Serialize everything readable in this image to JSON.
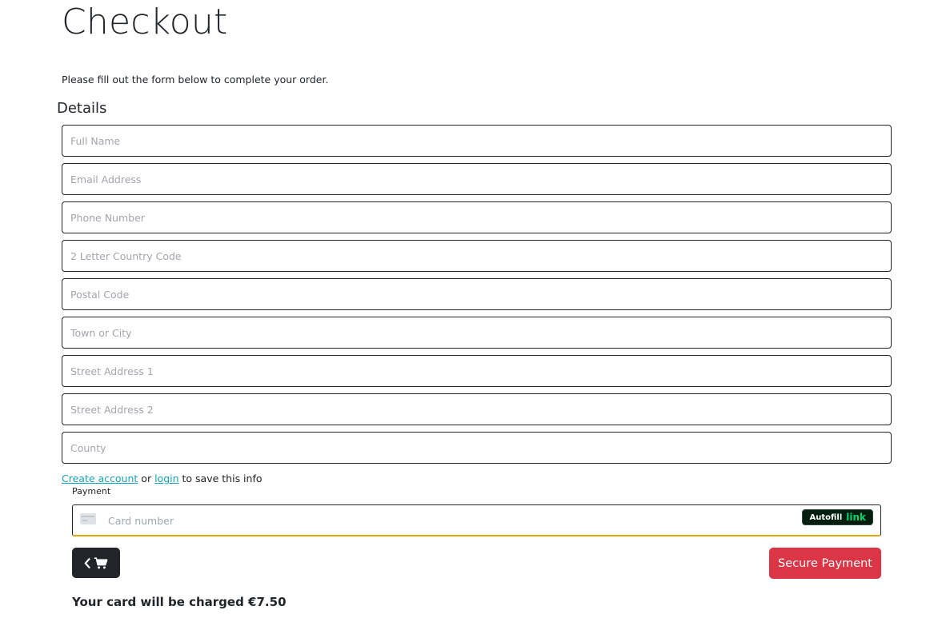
{
  "page": {
    "title": "Checkout",
    "intro": "Please fill out the form below to complete your order."
  },
  "details": {
    "heading": "Details",
    "fields": {
      "full_name": {
        "placeholder": "Full Name",
        "value": ""
      },
      "email": {
        "placeholder": "Email Address",
        "value": ""
      },
      "phone": {
        "placeholder": "Phone Number",
        "value": ""
      },
      "country": {
        "placeholder": "2 Letter Country Code",
        "value": ""
      },
      "postal": {
        "placeholder": "Postal Code",
        "value": ""
      },
      "town": {
        "placeholder": "Town or City",
        "value": ""
      },
      "street1": {
        "placeholder": "Street Address 1",
        "value": ""
      },
      "street2": {
        "placeholder": "Street Address 2",
        "value": ""
      },
      "county": {
        "placeholder": "County",
        "value": ""
      }
    }
  },
  "account": {
    "create_link": "Create account",
    "or_text": "or",
    "login_link": "login",
    "suffix_text": "to save this info"
  },
  "payment": {
    "label": "Payment",
    "card_placeholder": "Card number",
    "card_icon": "credit-card-icon",
    "autofill_text": "Autofill",
    "autofill_brand": "link"
  },
  "actions": {
    "back_icons": [
      "chevron-left-icon",
      "cart-icon"
    ],
    "pay_label": "Secure Payment"
  },
  "summary": {
    "charge_text": "Your card will be charged €7.50"
  },
  "colors": {
    "link": "#17a2b8",
    "pay_button": "#dc3545",
    "back_button": "#212529",
    "card_focus_underline": "#e0a800",
    "autofill_bg": "#011e0f",
    "autofill_brand": "#00d66f"
  }
}
